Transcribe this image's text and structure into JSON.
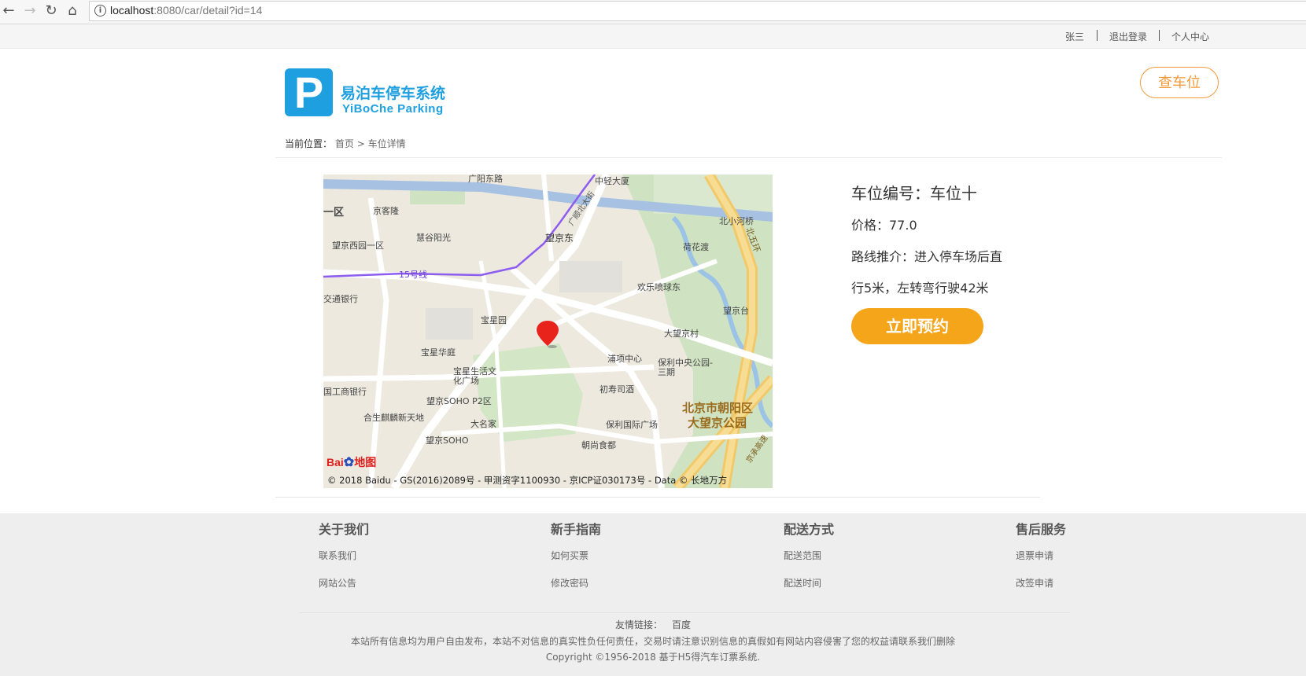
{
  "browser": {
    "url_host": "localhost",
    "url_path": ":8080/car/detail?id=14"
  },
  "topbar": {
    "user": "张三",
    "logout": "退出登录",
    "center": "个人中心"
  },
  "header": {
    "logo_letter": "P",
    "logo_cn": "易泊车停车系统",
    "logo_en": "YiBoChe  Parking",
    "find_button": "查车位"
  },
  "breadcrumb": {
    "label": "当前位置：",
    "home": "首页",
    "sep": ">",
    "current": "车位详情"
  },
  "map": {
    "labels": [
      "北京市朝阳区",
      "大望京公园",
      "望京东",
      "京客隆",
      "慧谷阳光",
      "望京西园一区",
      "中轻大厦",
      "北小河桥",
      "荷花渡",
      "欢乐喷球东",
      "望京台",
      "大望京村",
      "宝星园",
      "宝星华庭",
      "宝星生活文化广场",
      "浦项中心",
      "保利中央公园-三期",
      "初寿司酒",
      "望京SOHO P2区",
      "合生麒麟新天地",
      "大名家",
      "保利国际广场",
      "望京SOHO",
      "朝尚食都",
      "交通银行",
      "国工商银行",
      "15号线",
      "一区",
      "广顺北大街",
      "京承高速",
      "北五环",
      "广阳东路"
    ],
    "logo_text": "Bai",
    "logo_text2": "地图",
    "copyright": "© 2018 Baidu - GS(2016)2089号 - 甲测资字1100930 - 京ICP证030173号 - Data © 长地万方"
  },
  "detail": {
    "title": "车位编号：车位十",
    "price": "价格：77.0",
    "route_line1": "路线推介：进入停车场后直",
    "route_line2": "行5米，左转弯行驶42米",
    "book_button": "立即预约"
  },
  "footer": {
    "columns": [
      {
        "heading": "关于我们",
        "links": [
          "联系我们",
          "网站公告"
        ]
      },
      {
        "heading": "新手指南",
        "links": [
          "如何买票",
          "修改密码"
        ]
      },
      {
        "heading": "配送方式",
        "links": [
          "配送范围",
          "配送时间"
        ]
      },
      {
        "heading": "售后服务",
        "links": [
          "退票申请",
          "改签申请"
        ]
      }
    ],
    "friend_label": "友情链接：",
    "friend_link": "百度",
    "note": "本站所有信息均为用户自由发布，本站不对信息的真实性负任何责任，交易时请注意识别信息的真假如有网站内容侵害了您的权益请联系我们删除",
    "copyright": "Copyright ©1956-2018 基于H5得汽车订票系统."
  },
  "colors": {
    "brand_blue": "#1e9fe0",
    "accent_orange": "#f5a51a",
    "outline_orange": "#f39a3b"
  }
}
